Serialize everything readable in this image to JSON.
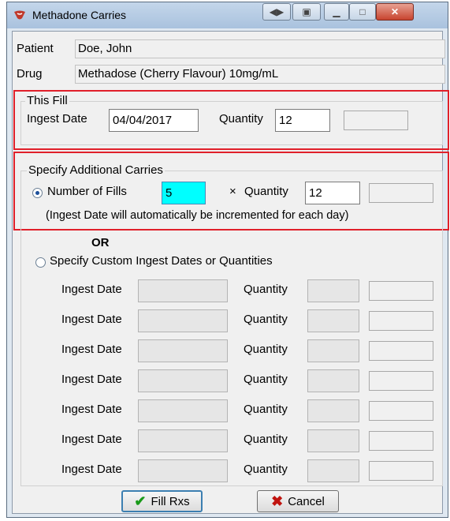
{
  "window": {
    "title": "Methadone Carries",
    "app_icon": "methadone-icon",
    "icon_color": "#c0392b"
  },
  "patient": {
    "label": "Patient",
    "value": "Doe, John"
  },
  "drug": {
    "label": "Drug",
    "value": "Methadose (Cherry Flavour) 10mg/mL"
  },
  "this_fill": {
    "group_label": "This Fill",
    "ingest_label": "Ingest Date",
    "ingest_value": "04/04/2017",
    "quantity_label": "Quantity",
    "quantity_value": "12"
  },
  "additional": {
    "group_label": "Specify Additional Carries",
    "fills_label": "Number of Fills",
    "fills_value": "5",
    "times_symbol": "×",
    "quantity_label": "Quantity",
    "quantity_value": "12",
    "note": "(Ingest Date will automatically be incremented for each day)"
  },
  "or_label": "OR",
  "custom": {
    "label": "Specify Custom Ingest Dates or Quantities",
    "rows": [
      {
        "date_label": "Ingest Date",
        "qty_label": "Quantity"
      },
      {
        "date_label": "Ingest Date",
        "qty_label": "Quantity"
      },
      {
        "date_label": "Ingest Date",
        "qty_label": "Quantity"
      },
      {
        "date_label": "Ingest Date",
        "qty_label": "Quantity"
      },
      {
        "date_label": "Ingest Date",
        "qty_label": "Quantity"
      },
      {
        "date_label": "Ingest Date",
        "qty_label": "Quantity"
      },
      {
        "date_label": "Ingest Date",
        "qty_label": "Quantity"
      }
    ]
  },
  "buttons": {
    "fill_label": "Fill Rxs",
    "cancel_label": "Cancel"
  },
  "colors": {
    "highlight_field": "#00ffff",
    "red_box": "#e0202a",
    "check_green": "#1a9a1a",
    "cancel_red": "#c0140f"
  }
}
